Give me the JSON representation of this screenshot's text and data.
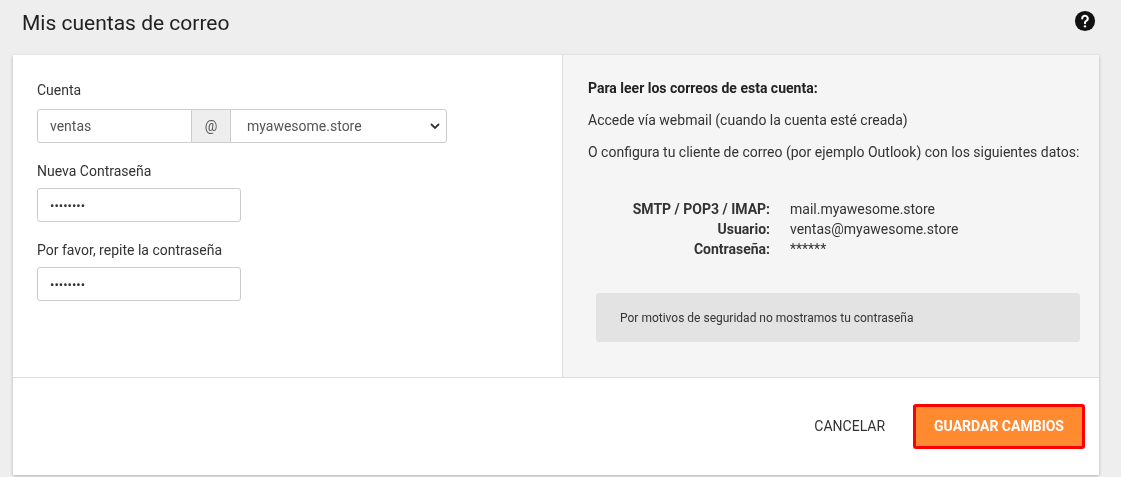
{
  "header": {
    "title": "Mis cuentas de correo"
  },
  "form": {
    "account_label": "Cuenta",
    "user_value": "ventas",
    "at_sign": "@",
    "domain_value": "myawesome.store",
    "fields": [
      {
        "label": "Nueva Contraseña",
        "value": "••••••••"
      },
      {
        "label": "Por favor, repite la contraseña",
        "value": "••••••••"
      }
    ]
  },
  "info": {
    "heading": "Para leer los correos de esta cuenta:",
    "lines": [
      "Accede vía webmail (cuando la cuenta esté creada)",
      "O configura tu cliente de correo (por ejemplo Outlook) con los siguientes datos:"
    ],
    "details": [
      {
        "label": "SMTP / POP3 / IMAP:",
        "value": "mail.myawesome.store"
      },
      {
        "label": "Usuario:",
        "value": "ventas@myawesome.store"
      },
      {
        "label": "Contraseña:",
        "value": "******"
      }
    ],
    "notice": "Por motivos de seguridad no mostramos tu contraseña"
  },
  "buttons": [
    {
      "label": "CANCELAR",
      "kind": "text",
      "highlighted": false
    },
    {
      "label": "GUARDAR CAMBIOS",
      "kind": "primary",
      "highlighted": true
    }
  ]
}
